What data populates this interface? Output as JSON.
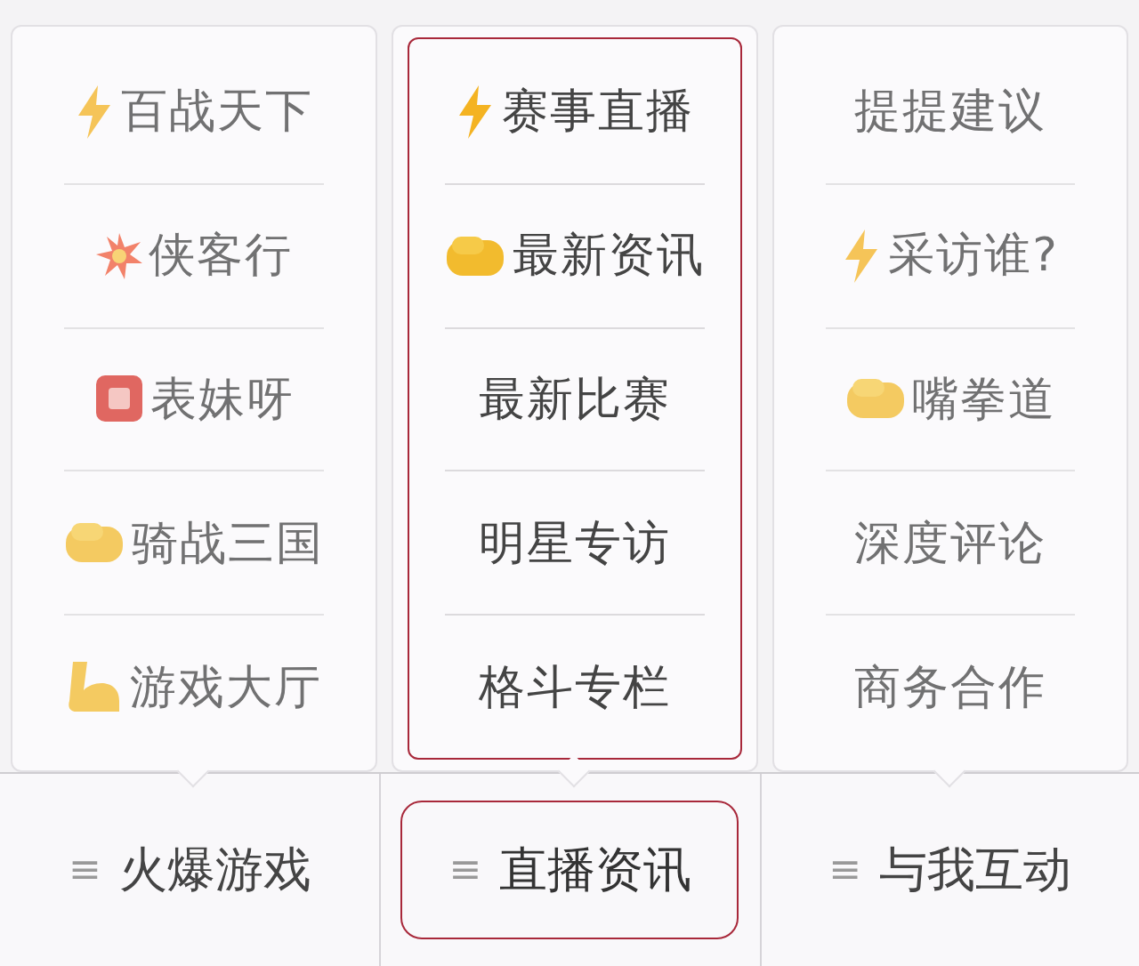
{
  "menus": [
    {
      "dimmed": true,
      "highlighted": false,
      "items": [
        {
          "kind": "bolt",
          "label": "百战天下"
        },
        {
          "kind": "burst",
          "label": "侠客行"
        },
        {
          "kind": "tile",
          "label": "表妹呀"
        },
        {
          "kind": "fist",
          "label": "骑战三国"
        },
        {
          "kind": "muscle",
          "label": "游戏大厅"
        }
      ]
    },
    {
      "dimmed": false,
      "highlighted": true,
      "items": [
        {
          "kind": "bolt",
          "label": "赛事直播"
        },
        {
          "kind": "fist",
          "label": "最新资讯"
        },
        {
          "kind": "plain",
          "label": "最新比赛"
        },
        {
          "kind": "plain",
          "label": "明星专访"
        },
        {
          "kind": "plain",
          "label": "格斗专栏"
        }
      ]
    },
    {
      "dimmed": true,
      "highlighted": false,
      "items": [
        {
          "kind": "plain",
          "label": "提提建议"
        },
        {
          "kind": "bolt",
          "label": "采访谁?"
        },
        {
          "kind": "fist",
          "label": "嘴拳道"
        },
        {
          "kind": "plain",
          "label": "深度评论"
        },
        {
          "kind": "plain",
          "label": "商务合作"
        }
      ]
    }
  ],
  "tabs": [
    {
      "glyph": "≡",
      "label": "火爆游戏",
      "selected": false
    },
    {
      "glyph": "≡",
      "label": "直播资讯",
      "selected": true
    },
    {
      "glyph": "≡",
      "label": "与我互动",
      "selected": false
    }
  ]
}
